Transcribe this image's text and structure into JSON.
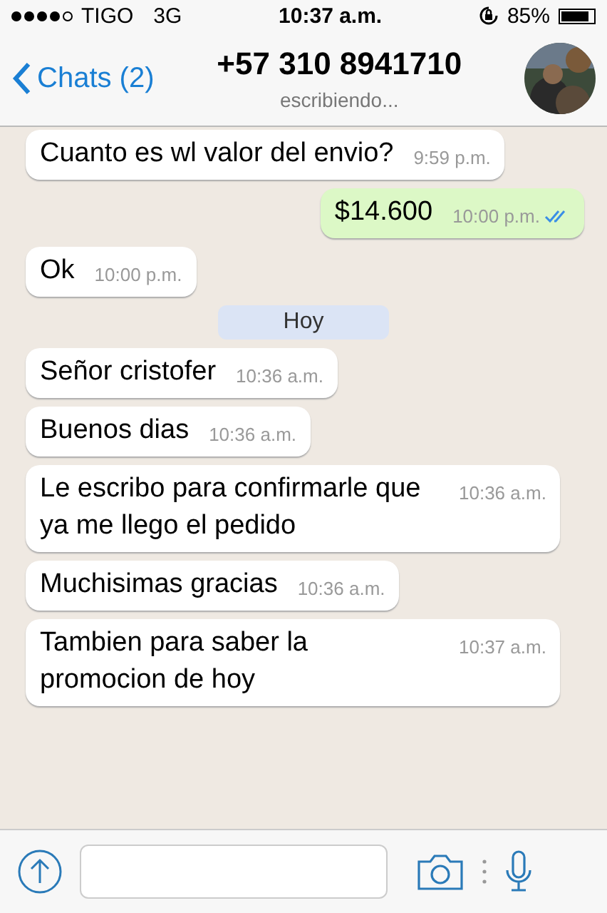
{
  "status_bar": {
    "carrier": "TIGO",
    "network": "3G",
    "time": "10:37 a.m.",
    "battery": "85%"
  },
  "header": {
    "back_label": "Chats (2)",
    "title": "+57 310 8941710",
    "subtitle": "escribiendo..."
  },
  "messages": [
    {
      "kind": "in",
      "text": "Cuanto es wl valor del envio?",
      "time": "9:59 p.m."
    },
    {
      "kind": "out",
      "text": "$14.600",
      "time": "10:00 p.m.",
      "read": true
    },
    {
      "kind": "in",
      "text": "Ok",
      "time": "10:00 p.m."
    },
    {
      "kind": "date",
      "text": "Hoy"
    },
    {
      "kind": "in",
      "text": "Señor cristofer",
      "time": "10:36 a.m."
    },
    {
      "kind": "in",
      "text": "Buenos dias",
      "time": "10:36 a.m."
    },
    {
      "kind": "in",
      "text": "Le escribo para confirmarle que ya me llego el pedido",
      "time": "10:36 a.m."
    },
    {
      "kind": "in",
      "text": "Muchisimas gracias",
      "time": "10:36 a.m."
    },
    {
      "kind": "in",
      "text": "Tambien para saber la promocion de hoy",
      "time": "10:37 a.m."
    }
  ]
}
